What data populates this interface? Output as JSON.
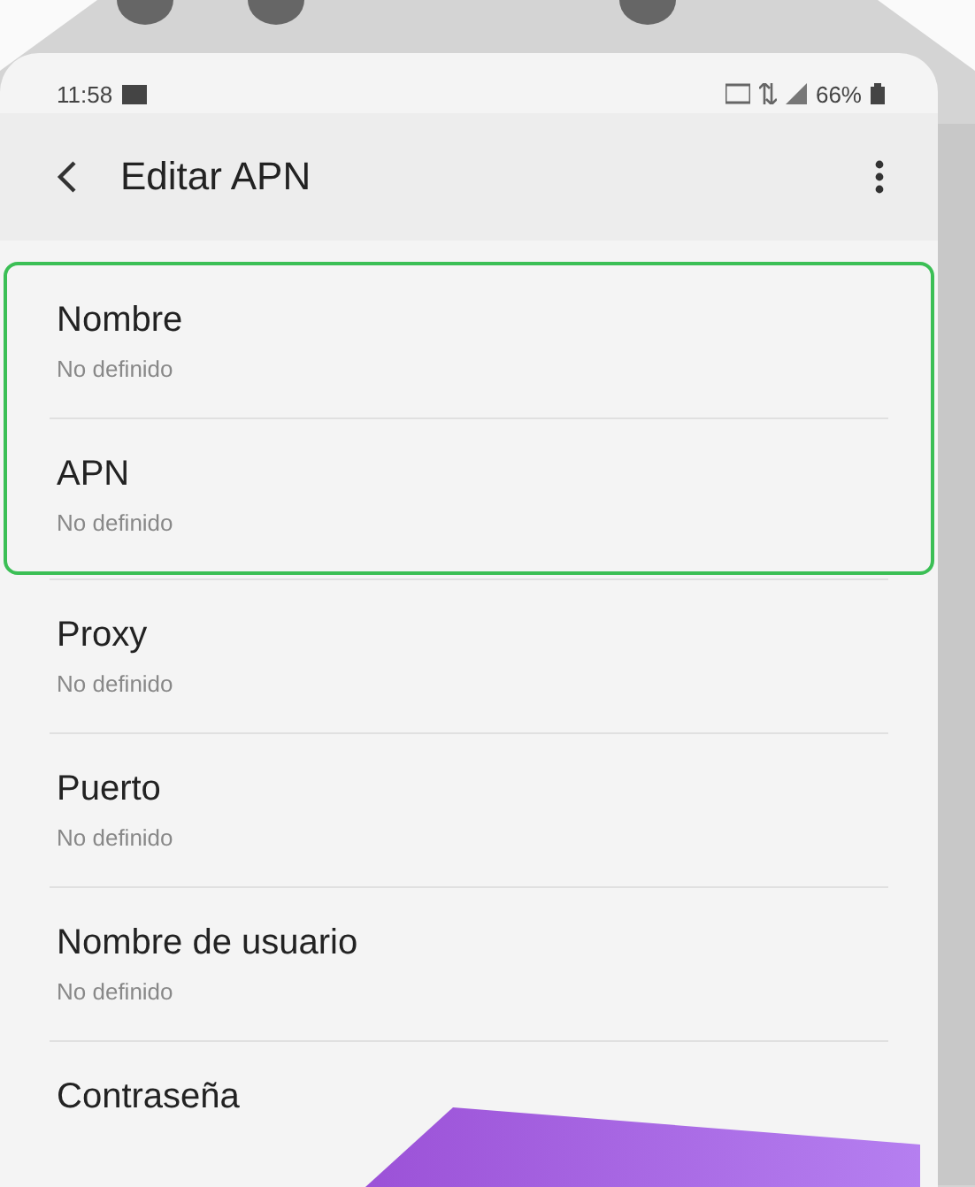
{
  "status_bar": {
    "time": "11:58",
    "battery": "66%"
  },
  "header": {
    "title": "Editar APN"
  },
  "groups": [
    {
      "highlighted": true,
      "items": [
        {
          "title": "Nombre",
          "value": "No definido"
        },
        {
          "title": "APN",
          "value": "No definido"
        }
      ]
    },
    {
      "highlighted": false,
      "items": [
        {
          "title": "Proxy",
          "value": "No definido"
        },
        {
          "title": "Puerto",
          "value": "No definido"
        },
        {
          "title": "Nombre de usuario",
          "value": "No definido"
        },
        {
          "title": "Contraseña"
        }
      ]
    }
  ]
}
